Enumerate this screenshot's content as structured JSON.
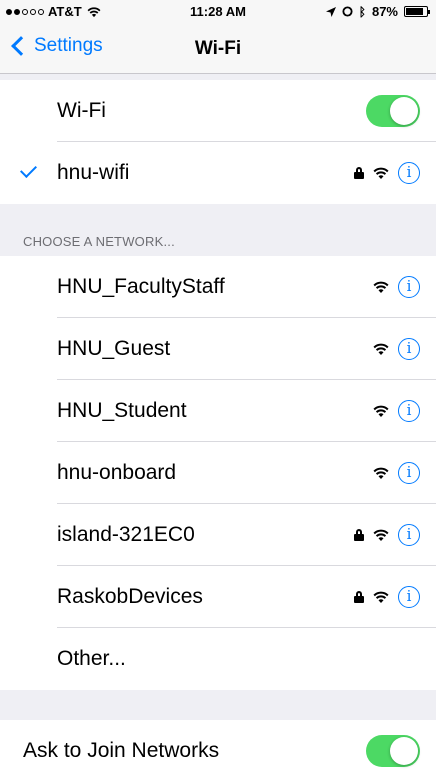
{
  "status_bar": {
    "carrier": "AT&T",
    "time": "11:28 AM",
    "battery": "87%",
    "battery_level": 0.87
  },
  "nav": {
    "back_label": "Settings",
    "title": "Wi-Fi"
  },
  "wifi_toggle": {
    "label": "Wi-Fi",
    "on": true
  },
  "connected": {
    "name": "hnu-wifi",
    "locked": true
  },
  "section_header": "CHOOSE A NETWORK...",
  "networks": [
    {
      "name": "HNU_FacultyStaff",
      "locked": false
    },
    {
      "name": "HNU_Guest",
      "locked": false
    },
    {
      "name": "HNU_Student",
      "locked": false
    },
    {
      "name": "hnu-onboard",
      "locked": false
    },
    {
      "name": "island-321EC0",
      "locked": true
    },
    {
      "name": "RaskobDevices",
      "locked": true
    }
  ],
  "other_label": "Other...",
  "ask_to_join": {
    "label": "Ask to Join Networks",
    "on": true
  },
  "colors": {
    "accent": "#007aff",
    "toggle_on": "#4cd964",
    "background": "#efeff4"
  }
}
